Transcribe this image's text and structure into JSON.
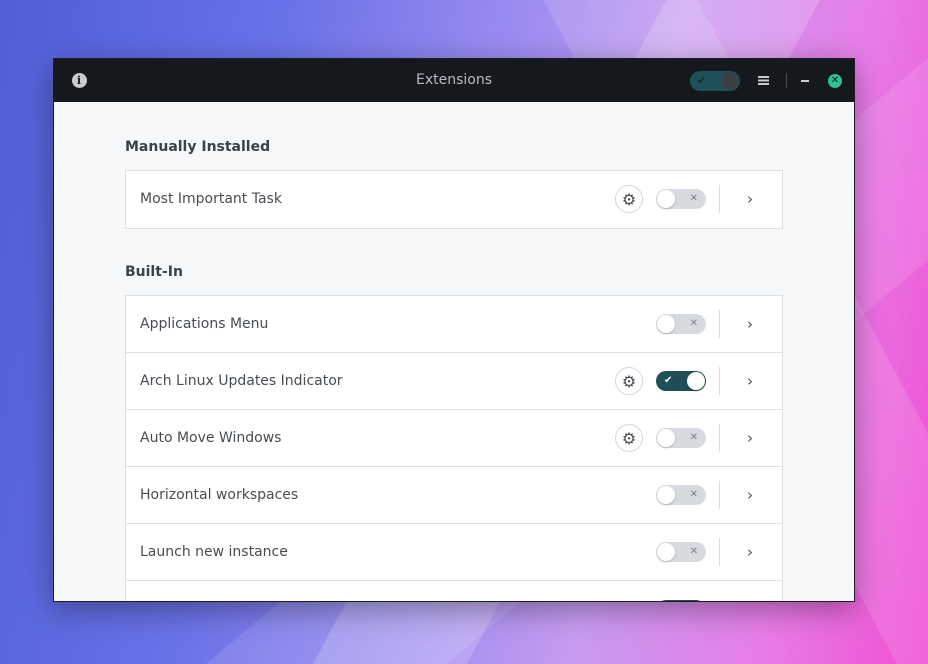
{
  "window": {
    "title": "Extensions",
    "global_toggle": "on"
  },
  "icons": {
    "info": "i",
    "close": "✕",
    "check": "✔",
    "cross": "✕",
    "gear": "⚙",
    "chevron": "›"
  },
  "colors": {
    "titlebar_bg": "#15181c",
    "accent_on": "#1f4e57",
    "close_button": "#2ebf8f",
    "switch_off": "#d7dbe0"
  },
  "sections": [
    {
      "title": "Manually Installed",
      "items": [
        {
          "name": "Most Important Task",
          "has_settings": true,
          "enabled": false
        }
      ]
    },
    {
      "title": "Built-In",
      "items": [
        {
          "name": "Applications Menu",
          "has_settings": false,
          "enabled": false
        },
        {
          "name": "Arch Linux Updates Indicator",
          "has_settings": true,
          "enabled": true
        },
        {
          "name": "Auto Move Windows",
          "has_settings": true,
          "enabled": false
        },
        {
          "name": "Horizontal workspaces",
          "has_settings": false,
          "enabled": false
        },
        {
          "name": "Launch new instance",
          "has_settings": false,
          "enabled": false
        }
      ]
    }
  ]
}
